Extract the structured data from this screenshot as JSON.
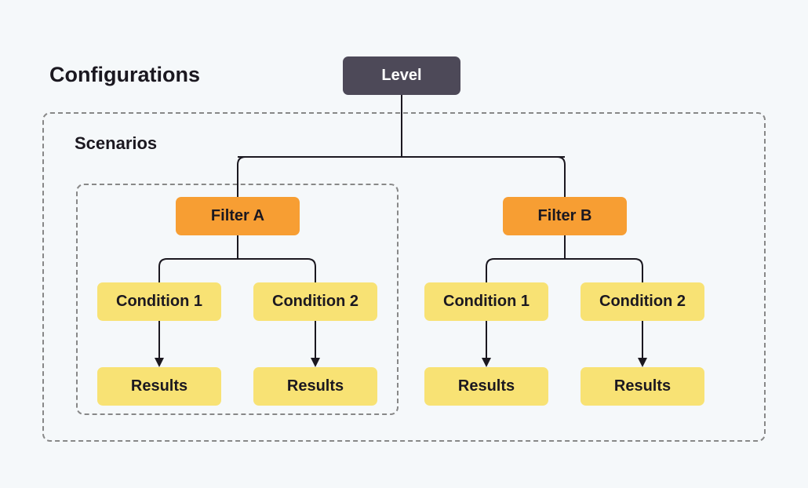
{
  "headings": {
    "configurations": "Configurations",
    "scenarios": "Scenarios"
  },
  "nodes": {
    "level": "Level",
    "filterA": "Filter A",
    "filterB": "Filter B",
    "condA1": "Condition 1",
    "condA2": "Condition 2",
    "condB1": "Condition 1",
    "condB2": "Condition 2",
    "resA1": "Results",
    "resA2": "Results",
    "resB1": "Results",
    "resB2": "Results"
  }
}
